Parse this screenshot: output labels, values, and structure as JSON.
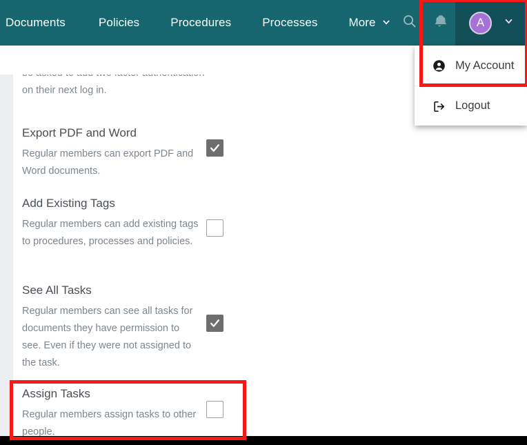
{
  "navbar": {
    "background_color": "#17656e",
    "items": [
      {
        "id": "documents",
        "label": "Documents"
      },
      {
        "id": "policies",
        "label": "Policies"
      },
      {
        "id": "procedures",
        "label": "Procedures"
      },
      {
        "id": "processes",
        "label": "Processes"
      },
      {
        "id": "more",
        "label": "More",
        "caret": "⌄"
      }
    ],
    "search_icon": "search-icon",
    "bell_icon": "bell-icon",
    "account": {
      "avatar_initial": "A",
      "avatar_color": "#a772d8",
      "caret": "⌄",
      "background_color": "#134f59"
    }
  },
  "account_dropdown": {
    "items": [
      {
        "id": "my-account",
        "label": "My Account",
        "icon": "user-circle-icon"
      },
      {
        "id": "logout",
        "label": "Logout",
        "icon": "logout-icon"
      }
    ]
  },
  "content": {
    "clipped_paragraph": "be asked to add two factor authentication on their next log in.",
    "permissions": [
      {
        "id": "export-pdf-and-word",
        "title": "Export PDF and Word",
        "description": "Regular members can export PDF and Word documents.",
        "checked": true
      },
      {
        "id": "add-existing-tags",
        "title": "Add Existing Tags",
        "description": "Regular members can add existing tags to procedures, processes and policies.",
        "checked": false
      },
      {
        "id": "see-all-tasks",
        "title": "See All Tasks",
        "description": "Regular members can see all tasks for documents they have permission to see. Even if they were not assigned to the task.",
        "checked": true
      },
      {
        "id": "assign-tasks",
        "title": "Assign Tasks",
        "description": "Regular members assign tasks to other people.",
        "checked": false
      }
    ]
  },
  "annotations": {
    "highlight_color": "#f71818",
    "boxes": [
      {
        "id": "account-menu-highlight",
        "target": "account-dropdown-and-button"
      },
      {
        "id": "assign-tasks-highlight",
        "target": "assign-tasks-row"
      }
    ]
  }
}
